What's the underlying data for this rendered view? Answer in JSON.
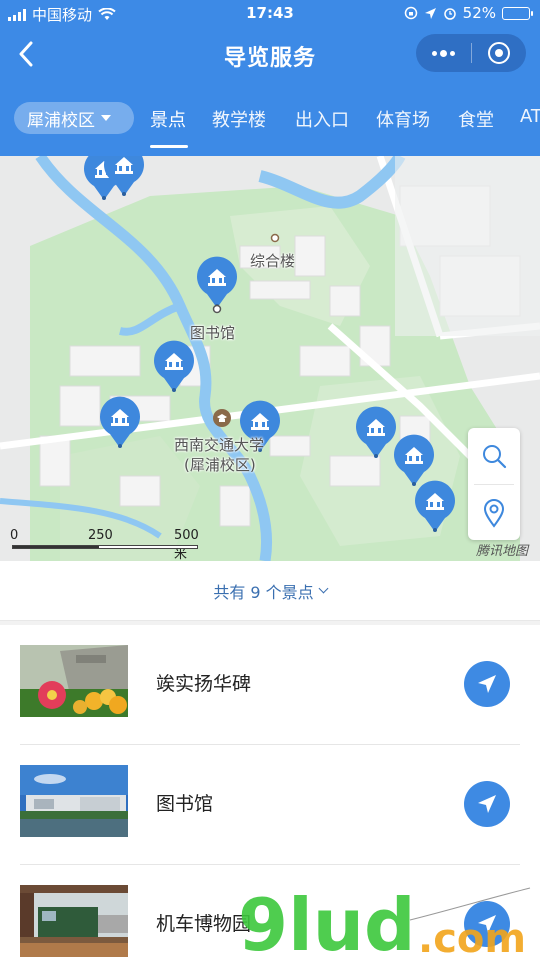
{
  "status_bar": {
    "carrier": "中国移动",
    "time": "17:43",
    "battery": "52%",
    "battery_level": 0.52
  },
  "header": {
    "title": "导览服务"
  },
  "tabs": {
    "campus": "犀浦校区",
    "items": [
      {
        "label": "景点"
      },
      {
        "label": "教学楼"
      },
      {
        "label": "出入口"
      },
      {
        "label": "体育场"
      },
      {
        "label": "食堂"
      },
      {
        "label": "AT"
      }
    ]
  },
  "map": {
    "labels": {
      "building": "综合楼",
      "library": "图书馆",
      "university_line1": "西南交通大学",
      "university_line2": "(犀浦校区)"
    },
    "scale": [
      "0",
      "250",
      "500 米"
    ],
    "provider": "腾讯地图"
  },
  "count": {
    "text": "共有 9 个景点"
  },
  "list": [
    {
      "name": "竢实扬华碑",
      "thumb": "monument-with-flowers"
    },
    {
      "name": "图书馆",
      "thumb": "library-building"
    },
    {
      "name": "机车博物园",
      "thumb": "locomotive"
    }
  ],
  "colors": {
    "primary": "#3d8ae6",
    "pin": "#3e88dd",
    "count_text": "#3a6fb0"
  }
}
